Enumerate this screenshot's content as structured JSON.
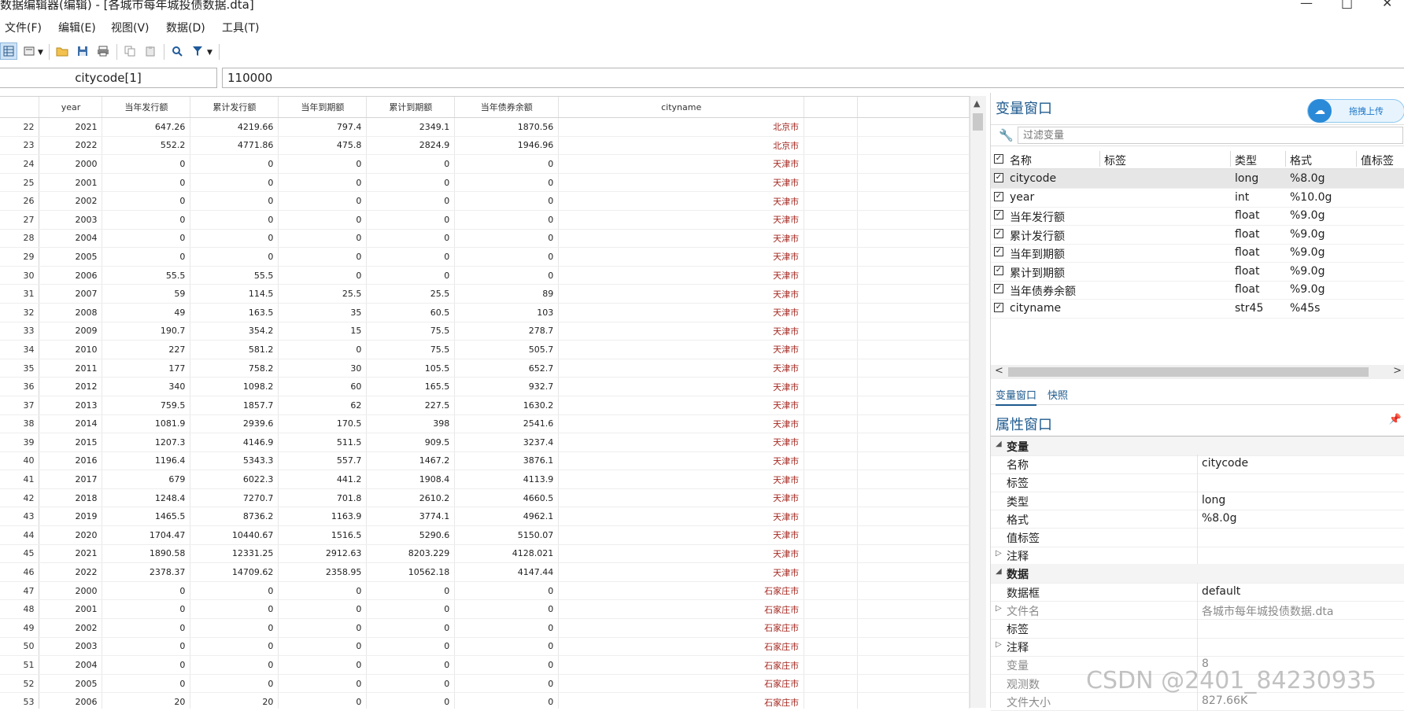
{
  "window": {
    "title": "数据编辑器(编辑) - [各城市每年城投债数据.dta]",
    "controls": [
      "—",
      "□",
      "✕"
    ]
  },
  "menu": [
    "文件(F)",
    "编辑(E)",
    "视图(V)",
    "数据(D)",
    "工具(T)"
  ],
  "toolbar": {
    "icons": [
      "grid-view-icon",
      "snapshot-icon",
      "open-folder-icon",
      "save-icon",
      "print-icon",
      "copy-icon",
      "paste-icon",
      "search-icon",
      "filter-icon"
    ]
  },
  "cellbar": {
    "varname": "citycode[1]",
    "value": "110000"
  },
  "grid": {
    "columns": [
      "",
      "year",
      "当年发行额",
      "累计发行额",
      "当年到期额",
      "累计到期额",
      "当年债券余额",
      "cityname",
      "",
      ""
    ],
    "rows": [
      [
        "22",
        "2021",
        "647.26",
        "4219.66",
        "797.4",
        "2349.1",
        "1870.56",
        "北京市"
      ],
      [
        "23",
        "2022",
        "552.2",
        "4771.86",
        "475.8",
        "2824.9",
        "1946.96",
        "北京市"
      ],
      [
        "24",
        "2000",
        "0",
        "0",
        "0",
        "0",
        "0",
        "天津市"
      ],
      [
        "25",
        "2001",
        "0",
        "0",
        "0",
        "0",
        "0",
        "天津市"
      ],
      [
        "26",
        "2002",
        "0",
        "0",
        "0",
        "0",
        "0",
        "天津市"
      ],
      [
        "27",
        "2003",
        "0",
        "0",
        "0",
        "0",
        "0",
        "天津市"
      ],
      [
        "28",
        "2004",
        "0",
        "0",
        "0",
        "0",
        "0",
        "天津市"
      ],
      [
        "29",
        "2005",
        "0",
        "0",
        "0",
        "0",
        "0",
        "天津市"
      ],
      [
        "30",
        "2006",
        "55.5",
        "55.5",
        "0",
        "0",
        "0",
        "天津市"
      ],
      [
        "31",
        "2007",
        "59",
        "114.5",
        "25.5",
        "25.5",
        "89",
        "天津市"
      ],
      [
        "32",
        "2008",
        "49",
        "163.5",
        "35",
        "60.5",
        "103",
        "天津市"
      ],
      [
        "33",
        "2009",
        "190.7",
        "354.2",
        "15",
        "75.5",
        "278.7",
        "天津市"
      ],
      [
        "34",
        "2010",
        "227",
        "581.2",
        "0",
        "75.5",
        "505.7",
        "天津市"
      ],
      [
        "35",
        "2011",
        "177",
        "758.2",
        "30",
        "105.5",
        "652.7",
        "天津市"
      ],
      [
        "36",
        "2012",
        "340",
        "1098.2",
        "60",
        "165.5",
        "932.7",
        "天津市"
      ],
      [
        "37",
        "2013",
        "759.5",
        "1857.7",
        "62",
        "227.5",
        "1630.2",
        "天津市"
      ],
      [
        "38",
        "2014",
        "1081.9",
        "2939.6",
        "170.5",
        "398",
        "2541.6",
        "天津市"
      ],
      [
        "39",
        "2015",
        "1207.3",
        "4146.9",
        "511.5",
        "909.5",
        "3237.4",
        "天津市"
      ],
      [
        "40",
        "2016",
        "1196.4",
        "5343.3",
        "557.7",
        "1467.2",
        "3876.1",
        "天津市"
      ],
      [
        "41",
        "2017",
        "679",
        "6022.3",
        "441.2",
        "1908.4",
        "4113.9",
        "天津市"
      ],
      [
        "42",
        "2018",
        "1248.4",
        "7270.7",
        "701.8",
        "2610.2",
        "4660.5",
        "天津市"
      ],
      [
        "43",
        "2019",
        "1465.5",
        "8736.2",
        "1163.9",
        "3774.1",
        "4962.1",
        "天津市"
      ],
      [
        "44",
        "2020",
        "1704.47",
        "10440.67",
        "1516.5",
        "5290.6",
        "5150.07",
        "天津市"
      ],
      [
        "45",
        "2021",
        "1890.58",
        "12331.25",
        "2912.63",
        "8203.229",
        "4128.021",
        "天津市"
      ],
      [
        "46",
        "2022",
        "2378.37",
        "14709.62",
        "2358.95",
        "10562.18",
        "4147.44",
        "天津市"
      ],
      [
        "47",
        "2000",
        "0",
        "0",
        "0",
        "0",
        "0",
        "石家庄市"
      ],
      [
        "48",
        "2001",
        "0",
        "0",
        "0",
        "0",
        "0",
        "石家庄市"
      ],
      [
        "49",
        "2002",
        "0",
        "0",
        "0",
        "0",
        "0",
        "石家庄市"
      ],
      [
        "50",
        "2003",
        "0",
        "0",
        "0",
        "0",
        "0",
        "石家庄市"
      ],
      [
        "51",
        "2004",
        "0",
        "0",
        "0",
        "0",
        "0",
        "石家庄市"
      ],
      [
        "52",
        "2005",
        "0",
        "0",
        "0",
        "0",
        "0",
        "石家庄市"
      ],
      [
        "53",
        "2006",
        "20",
        "20",
        "0",
        "0",
        "0",
        "石家庄市"
      ]
    ]
  },
  "varwindow": {
    "title": "变量窗口",
    "upload_label": "拖拽上传",
    "filter_placeholder": "过滤变量",
    "headers": [
      "名称",
      "标签",
      "类型",
      "格式",
      "值标签"
    ],
    "vars": [
      {
        "name": "citycode",
        "label": "",
        "type": "long",
        "format": "%8.0g"
      },
      {
        "name": "year",
        "label": "",
        "type": "int",
        "format": "%10.0g"
      },
      {
        "name": "当年发行额",
        "label": "",
        "type": "float",
        "format": "%9.0g"
      },
      {
        "name": "累计发行额",
        "label": "",
        "type": "float",
        "format": "%9.0g"
      },
      {
        "name": "当年到期额",
        "label": "",
        "type": "float",
        "format": "%9.0g"
      },
      {
        "name": "累计到期额",
        "label": "",
        "type": "float",
        "format": "%9.0g"
      },
      {
        "name": "当年债券余额",
        "label": "",
        "type": "float",
        "format": "%9.0g"
      },
      {
        "name": "cityname",
        "label": "",
        "type": "str45",
        "format": "%45s"
      }
    ],
    "tabs": [
      "变量窗口",
      "快照"
    ]
  },
  "propwindow": {
    "title": "属性窗口",
    "rows": [
      {
        "k": "变量",
        "v": "",
        "group": true,
        "tri": "◢"
      },
      {
        "k": "名称",
        "v": "citycode"
      },
      {
        "k": "标签",
        "v": ""
      },
      {
        "k": "类型",
        "v": "long"
      },
      {
        "k": "格式",
        "v": "%8.0g"
      },
      {
        "k": "值标签",
        "v": ""
      },
      {
        "k": "注释",
        "v": "",
        "tri": "▷"
      },
      {
        "k": "数据",
        "v": "",
        "group": true,
        "tri": "◢"
      },
      {
        "k": "数据框",
        "v": "default"
      },
      {
        "k": "文件名",
        "v": "各城市每年城投债数据.dta",
        "tri": "▷",
        "dim": true
      },
      {
        "k": "标签",
        "v": ""
      },
      {
        "k": "注释",
        "v": "",
        "tri": "▷"
      },
      {
        "k": "变量",
        "v": "8",
        "dim": true
      },
      {
        "k": "观测数",
        "v": "",
        "dim": true
      },
      {
        "k": "文件大小",
        "v": "827.66K",
        "dim": true
      }
    ]
  },
  "watermark": "CSDN @2401_84230935",
  "colors": {
    "accent": "#1e5a8e",
    "city_text": "#a3261e"
  }
}
